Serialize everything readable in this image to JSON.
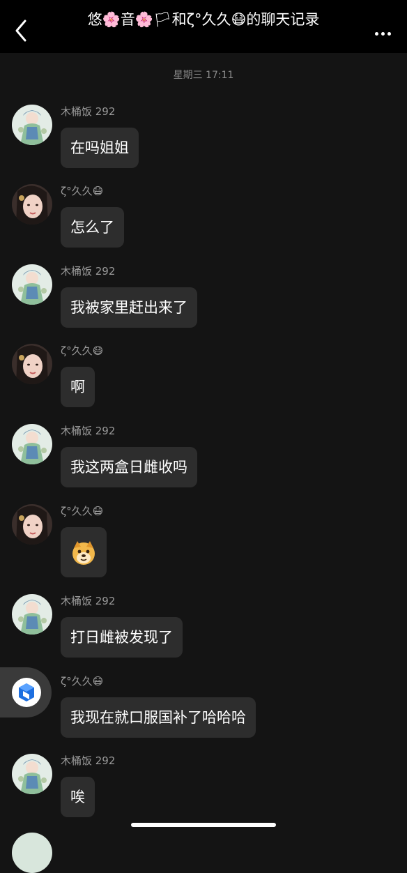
{
  "header": {
    "title": "悠🌸音🌸🏳和ζ°久久😷的聊天记录",
    "back_icon": "chevron-left-icon",
    "more_icon": "more-dots-icon"
  },
  "timestamp": "星期三 17:11",
  "messages": [
    {
      "sender": "木桶饭 292",
      "avatar": "anime-girl",
      "text": "在吗姐姐"
    },
    {
      "sender": "ζ°久久😷",
      "avatar": "woman-photo",
      "text": "怎么了"
    },
    {
      "sender": "木桶饭 292",
      "avatar": "anime-girl",
      "text": "我被家里赶出来了"
    },
    {
      "sender": "ζ°久久😷",
      "avatar": "woman-photo",
      "text": "啊"
    },
    {
      "sender": "木桶饭 292",
      "avatar": "anime-girl",
      "text": "我这两盒日雌收吗"
    },
    {
      "sender": "ζ°久久😷",
      "avatar": "woman-photo",
      "text": "😳",
      "is_sticker": true
    },
    {
      "sender": "木桶饭 292",
      "avatar": "anime-girl",
      "text": "打日雌被发现了"
    },
    {
      "sender": "ζ°久久😷",
      "avatar": "floating-cube",
      "text": "我现在就口服国补了哈哈哈"
    },
    {
      "sender": "木桶饭 292",
      "avatar": "anime-girl",
      "text": "唉"
    }
  ],
  "floating_button_icon": "cube-app-icon"
}
